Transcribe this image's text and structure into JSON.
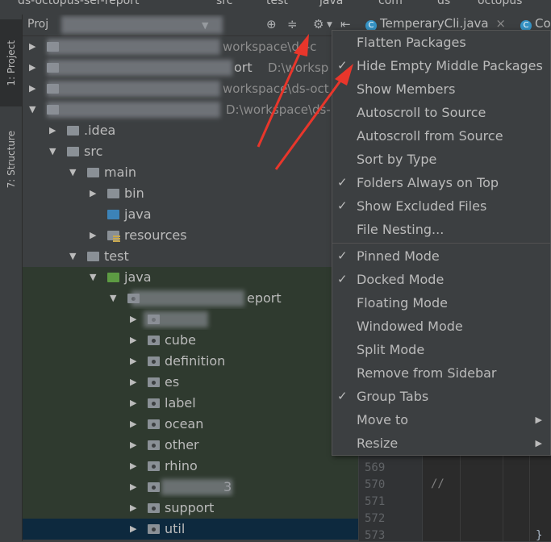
{
  "breadcrumb": [
    "ds-octopus-ser-report",
    "src",
    "test",
    "java",
    "com",
    "ds",
    "octopus"
  ],
  "tool_stripe": {
    "project_tab": "1: Project",
    "structure_tab": "7: Structure"
  },
  "panel": {
    "title": "Proj"
  },
  "tree": [
    {
      "label": "",
      "path": "workspace\\ds-c",
      "indent": 0,
      "arrow": "▶",
      "kind": "module",
      "blurred": true
    },
    {
      "label": "ort",
      "path": "D:\\worksp",
      "indent": 0,
      "arrow": "▶",
      "kind": "module",
      "blurred": true
    },
    {
      "label": "",
      "path": "workspace\\ds-oct",
      "indent": 0,
      "arrow": "▶",
      "kind": "module",
      "blurred": true
    },
    {
      "label": "",
      "path": "D:\\workspace\\ds-",
      "indent": 0,
      "arrow": "▼",
      "kind": "module",
      "blurred": true
    },
    {
      "label": ".idea",
      "indent": 1,
      "arrow": "▶",
      "kind": "folder"
    },
    {
      "label": "src",
      "indent": 1,
      "arrow": "▼",
      "kind": "folder"
    },
    {
      "label": "main",
      "indent": 2,
      "arrow": "▼",
      "kind": "folder"
    },
    {
      "label": "bin",
      "indent": 3,
      "arrow": "▶",
      "kind": "folder"
    },
    {
      "label": "java",
      "indent": 3,
      "arrow": "",
      "kind": "blue"
    },
    {
      "label": "resources",
      "indent": 3,
      "arrow": "▶",
      "kind": "res"
    },
    {
      "label": "test",
      "indent": 2,
      "arrow": "▼",
      "kind": "folder"
    },
    {
      "label": "java",
      "indent": 3,
      "arrow": "▼",
      "kind": "green",
      "green": true
    },
    {
      "label": "eport",
      "indent": 4,
      "arrow": "▼",
      "kind": "pkg",
      "green": true,
      "blurred": true
    },
    {
      "label": "",
      "indent": 5,
      "arrow": "▶",
      "kind": "pkg",
      "green": true,
      "blurred": true
    },
    {
      "label": "cube",
      "indent": 5,
      "arrow": "▶",
      "kind": "pkg",
      "green": true
    },
    {
      "label": "definition",
      "indent": 5,
      "arrow": "▶",
      "kind": "pkg",
      "green": true
    },
    {
      "label": "es",
      "indent": 5,
      "arrow": "▶",
      "kind": "pkg",
      "green": true
    },
    {
      "label": "label",
      "indent": 5,
      "arrow": "▶",
      "kind": "pkg",
      "green": true
    },
    {
      "label": "ocean",
      "indent": 5,
      "arrow": "▶",
      "kind": "pkg",
      "green": true
    },
    {
      "label": "other",
      "indent": 5,
      "arrow": "▶",
      "kind": "pkg",
      "green": true
    },
    {
      "label": "rhino",
      "indent": 5,
      "arrow": "▶",
      "kind": "pkg",
      "green": true
    },
    {
      "label": "3",
      "indent": 5,
      "arrow": "▶",
      "kind": "pkg",
      "green": true,
      "blurred": true
    },
    {
      "label": "support",
      "indent": 5,
      "arrow": "▶",
      "kind": "pkg",
      "green": true
    },
    {
      "label": "util",
      "indent": 5,
      "arrow": "▶",
      "kind": "pkg",
      "selected": true
    }
  ],
  "editor": {
    "tabs": [
      {
        "label": "TemperaryCli.java",
        "close": "×"
      },
      {
        "label": "Co"
      }
    ],
    "line_numbers": [
      "569",
      "570",
      "571",
      "572",
      "573"
    ],
    "comment": "//",
    "brace": "}"
  },
  "menu": {
    "items": [
      {
        "label": "Flatten Packages",
        "checked": false
      },
      {
        "label": "Hide Empty Middle Packages",
        "checked": true
      },
      {
        "label": "Show Members",
        "checked": false
      },
      {
        "label": "Autoscroll to Source",
        "checked": false
      },
      {
        "label": "Autoscroll from Source",
        "checked": false
      },
      {
        "label": "Sort by Type",
        "checked": false
      },
      {
        "label": "Folders Always on Top",
        "checked": true
      },
      {
        "label": "Show Excluded Files",
        "checked": true
      },
      {
        "label": "File Nesting...",
        "checked": false,
        "separator_after": true
      },
      {
        "label": "Pinned Mode",
        "checked": true
      },
      {
        "label": "Docked Mode",
        "checked": true
      },
      {
        "label": "Floating Mode",
        "checked": false
      },
      {
        "label": "Windowed Mode",
        "checked": false
      },
      {
        "label": "Split Mode",
        "checked": false
      },
      {
        "label": "Remove from Sidebar",
        "checked": false
      },
      {
        "label": "Group Tabs",
        "checked": true
      },
      {
        "label": "Move to",
        "checked": false,
        "submenu": true
      },
      {
        "label": "Resize",
        "checked": false,
        "submenu": true
      }
    ]
  },
  "colors": {
    "background": "#3c3f41",
    "selection": "#0d293e",
    "test_root": "#2f3a2f",
    "annotation_arrow": "#e8362b"
  }
}
